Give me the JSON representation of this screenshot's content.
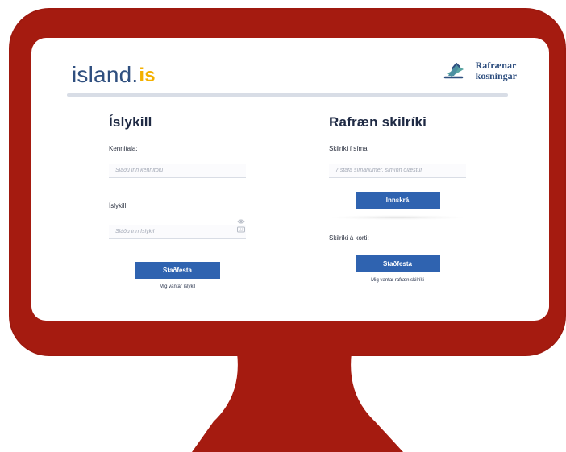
{
  "brand": {
    "logo_main": "island",
    "logo_dot": ".",
    "logo_suffix": "is",
    "e_voting_label": "Rafrænar\nkosningar"
  },
  "left": {
    "title": "Íslykill",
    "kennitala_label": "Kennitala:",
    "kennitala_placeholder": "Sláðu inn kennitölu",
    "islykill_label": "Íslykill:",
    "islykill_placeholder": "Sláðu inn Íslykil",
    "submit_label": "Staðfesta",
    "link_label": "Mig vantar íslykil"
  },
  "right": {
    "title": "Rafræn skilríki",
    "phone_label": "Skilríki í síma:",
    "phone_placeholder": "7 stafa símanúmer, símínn ólæstur",
    "phone_submit_label": "Innskrá",
    "card_label": "Skilríki á korti:",
    "card_submit_label": "Staðfesta",
    "link_label": "Mig vantar rafræn skilríki"
  },
  "colors": {
    "monitor_red": "#a51b10",
    "primary_blue": "#2f63b0",
    "logo_blue": "#2f4f7f",
    "logo_yellow": "#f4b000"
  },
  "icons": {
    "eye": "eye-icon",
    "keyboard": "keyboard-icon",
    "ballot": "ballot-icon"
  }
}
